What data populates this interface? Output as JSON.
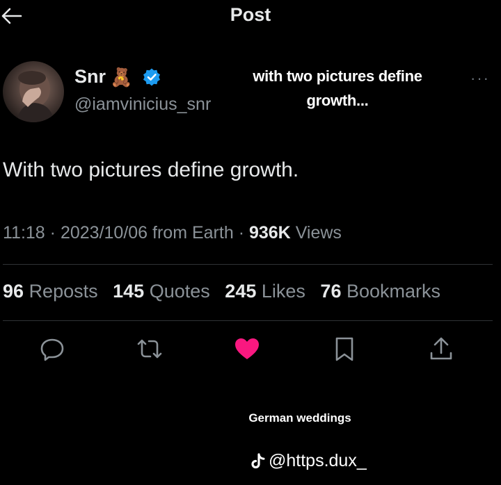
{
  "header": {
    "title": "Post"
  },
  "author": {
    "name": "Snr",
    "emoji": "🧸",
    "handle": "@iamvinicius_snr"
  },
  "overlay_caption": "with two pictures define growth...",
  "tweet": {
    "text": "With two pictures define growth."
  },
  "meta": {
    "time": "11:18",
    "date": "2023/10/06",
    "source": "from Earth",
    "views_count": "936K",
    "views_label": "Views"
  },
  "stats": {
    "reposts": {
      "count": "96",
      "label": "Reposts"
    },
    "quotes": {
      "count": "145",
      "label": "Quotes"
    },
    "likes": {
      "count": "245",
      "label": "Likes"
    },
    "bookmarks": {
      "count": "76",
      "label": "Bookmarks"
    }
  },
  "actions": [
    "reply-icon",
    "repost-icon",
    "like-icon",
    "bookmark-icon",
    "share-icon"
  ],
  "colors": {
    "background": "#000000",
    "like": "#f91880",
    "verified": "#1d9bf0",
    "muted": "#8b9298"
  },
  "video_text": {
    "caption": "German weddings",
    "watermark": "@https.dux_"
  }
}
